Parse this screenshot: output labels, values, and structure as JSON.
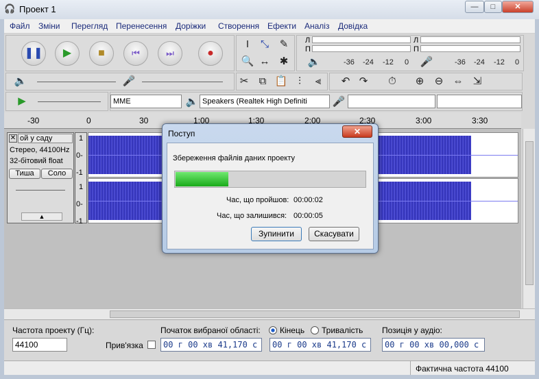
{
  "window": {
    "title": "Проект 1",
    "min": "—",
    "max": "□",
    "close": "✕"
  },
  "menu": [
    "Файл",
    "Зміни",
    "Перегляд",
    "Перенесення",
    "Доріжки",
    "Створення",
    "Ефекти",
    "Аналіз",
    "Довідка"
  ],
  "meters": {
    "left": "Л",
    "right": "П",
    "rec_ticks": [
      "-36",
      "-24",
      "-12",
      "0"
    ],
    "play_ticks": [
      "-36",
      "-24",
      "-12",
      "0"
    ]
  },
  "device": {
    "host": "MME",
    "output": "Speakers (Realtek High Definiti",
    "input": "",
    "channels": ""
  },
  "timeline": [
    "-30",
    "0",
    "30",
    "1:00",
    "1:30",
    "2:00",
    "2:30",
    "3:00",
    "3:30"
  ],
  "track": {
    "name": "ой у саду",
    "info1": "Стерео, 44100Hz",
    "info2": "32-бітовий float",
    "mute": "Тиша",
    "solo": "Соло",
    "close": "✕",
    "scale_top": [
      "1",
      "0-",
      "-1"
    ],
    "scale_bottom": [
      "1",
      "0-",
      "-1"
    ]
  },
  "dialog": {
    "title": "Поступ",
    "message": "Збереження файлів даних проекту",
    "progress": 0.28,
    "elapsed_label": "Час, що пройшов:",
    "elapsed": "00:00:02",
    "remaining_label": "Час, що залишився:",
    "remaining": "00:00:05",
    "stop": "Зупинити",
    "cancel": "Скасувати"
  },
  "selection": {
    "rate_label": "Частота проекту (Гц):",
    "rate": "44100",
    "snap_label": "Прив'язка",
    "start_label": "Початок вибраної області:",
    "end_label": "Кінець",
    "length_label": "Тривалість",
    "audio_pos_label": "Позиція у аудіо:",
    "start": "00 г 00 хв 41,170 с",
    "end": "00 г 00 хв 41,170 с",
    "audio_pos": "00 г 00 хв 00,000 с"
  },
  "status": {
    "actual_rate": "Фактична частота 44100"
  }
}
